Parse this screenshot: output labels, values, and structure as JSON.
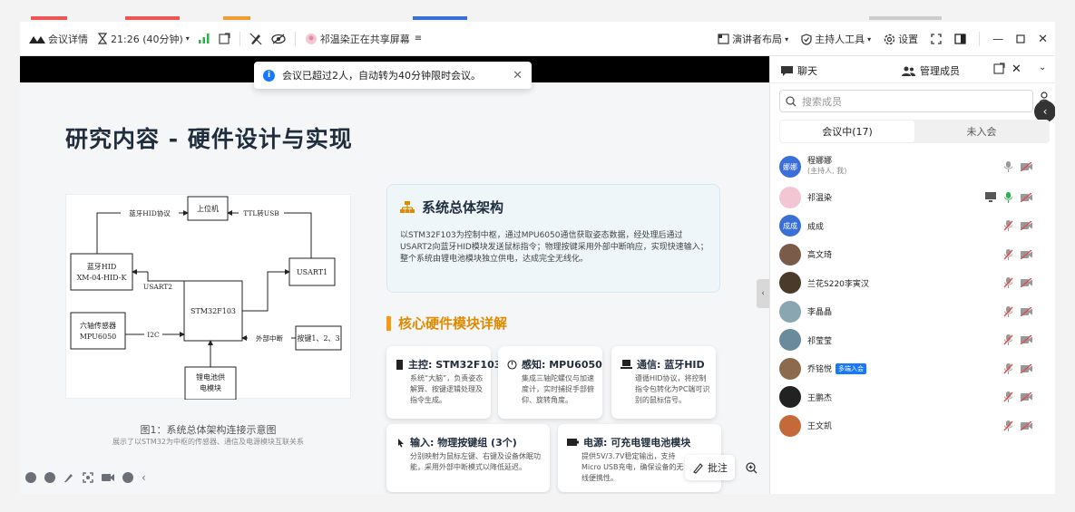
{
  "toolbar": {
    "meeting_details": "会议详情",
    "timer": "21:26 (40分钟)",
    "share_status": "祁温染正在共享屏幕",
    "presenter_layout": "演讲者布局",
    "host_tools": "主持人工具",
    "settings": "设置"
  },
  "toast": {
    "message": "会议已超过2人，自动转为40分钟限时会议。"
  },
  "slide": {
    "title": "研究内容 - 硬件设计与实现",
    "diagram": {
      "host": "上位机",
      "bt_hid_line1": "蓝牙HID",
      "bt_hid_line2": "XM-04-HID-K",
      "usart1": "USART1",
      "mcu": "STM32F103",
      "imu_line1": "六轴传感器",
      "imu_line2": "MPU6050",
      "buttons": "按键1、2、3",
      "battery_line1": "锂电池供",
      "battery_line2": "电模块",
      "edge_bt": "蓝牙HID协议",
      "edge_ttl": "TTL转USB",
      "edge_usart2": "USART2",
      "edge_i2c": "I2C",
      "edge_ext": "外部中断"
    },
    "caption": "图1：系统总体架构连接示意图",
    "caption_sub": "展示了以STM32为中枢的传感器、通信及电源模块互联关系",
    "system_title": "系统总体架构",
    "system_desc": "以STM32F103为控制中枢，通过MPU6050通信获取姿态数据，经处理后通过USART2向蓝牙HID模块发送鼠标指令；物理按键采用外部中断响应，实现快速输入；整个系统由锂电池模块独立供电，达成完全无线化。",
    "modules_title": "核心硬件模块详解",
    "cards": [
      {
        "title": "主控: STM32F103",
        "desc": "系统“大脑”，负责姿态解算、按键逻辑处理及指令生成。"
      },
      {
        "title": "感知: MPU6050",
        "desc": "集成三轴陀螺仪与加速度计，实时捕捉手部俯仰、旋转角度。"
      },
      {
        "title": "通信: 蓝牙HID",
        "desc": "遵循HID协议，将控制指令包转化为PC端可识别的鼠标信号。"
      },
      {
        "title": "输入: 物理按键组 (3个)",
        "desc": "分别映射为鼠标左键、右键及设备休眠功能，采用外部中断模式以降低延迟。"
      },
      {
        "title": "电源: 可充电锂电池模块",
        "desc": "提供5V/3.7V稳定输出，支持Micro USB充电，确保设备的无线便携性。"
      }
    ]
  },
  "annotate_label": "批注",
  "panel": {
    "chat_tab": "聊天",
    "members_tab": "管理成员",
    "search_placeholder": "搜索成员",
    "in_meeting": "会议中(17)",
    "not_joined": "未入会",
    "members": [
      {
        "name": "程娜娜",
        "sub": "(主持人, 我)",
        "avatar": "娜娜",
        "color": "#3b6fd8",
        "mic": "on"
      },
      {
        "name": "祁温染",
        "sub": "",
        "avatar": "",
        "color": "#f2c7d3",
        "mic": "active",
        "sharing": true
      },
      {
        "name": "成成",
        "sub": "",
        "avatar": "成成",
        "color": "#3b6fd8",
        "mic": "muted"
      },
      {
        "name": "高文琦",
        "sub": "",
        "avatar": "",
        "color": "#7a5a48",
        "mic": "muted"
      },
      {
        "name": "兰花S220李寅汉",
        "sub": "",
        "avatar": "",
        "color": "#4a3a2a",
        "mic": "muted"
      },
      {
        "name": "李晶晶",
        "sub": "",
        "avatar": "",
        "color": "#8aa6b0",
        "mic": "muted"
      },
      {
        "name": "祁莹莹",
        "sub": "",
        "avatar": "",
        "color": "#6a8b9c",
        "mic": "muted"
      },
      {
        "name": "乔铭悦",
        "sub": "",
        "avatar": "",
        "color": "#8c6a4e",
        "mic": "muted",
        "badge": "多端入会"
      },
      {
        "name": "王鹏杰",
        "sub": "",
        "avatar": "",
        "color": "#222222",
        "mic": "muted"
      },
      {
        "name": "王文凯",
        "sub": "",
        "avatar": "",
        "color": "#c46a3a",
        "mic": "muted"
      }
    ]
  }
}
